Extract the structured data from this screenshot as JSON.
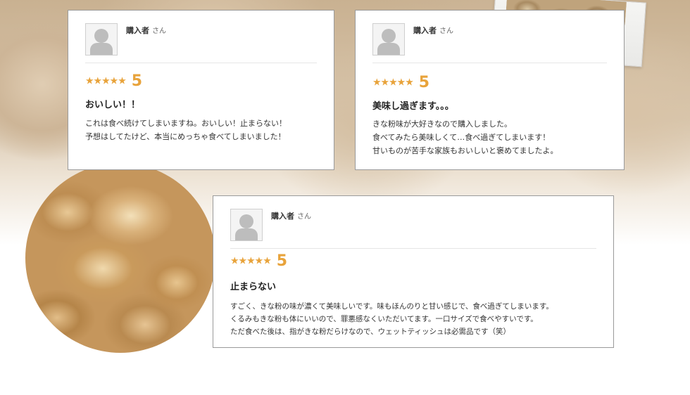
{
  "reviews": [
    {
      "reviewer": "購入者",
      "honorific": "さん",
      "stars": "★★★★★",
      "score": "5",
      "title": "おいしい！！",
      "lines": [
        "これは食べ続けてしまいますね。おいしい！止まらない！",
        "予想はしてたけど、本当にめっちゃ食べてしまいました！"
      ]
    },
    {
      "reviewer": "購入者",
      "honorific": "さん",
      "stars": "★★★★★",
      "score": "5",
      "title": "美味し過ぎます。。。",
      "lines": [
        "きな粉味が大好きなので購入しました。",
        "食べてみたら美味しくて…食べ過ぎてしまいます！",
        "甘いものが苦手な家族もおいしいと褒めてましたよ。"
      ]
    },
    {
      "reviewer": "購入者",
      "honorific": "さん",
      "stars": "★★★★★",
      "score": "5",
      "title": "止まらない",
      "lines": [
        "すごく、きな粉の味が濃くて美味しいです。味もほんのりと甘い感じで、食べ過ぎてしまいます。",
        "くるみもきな粉も体にいいので、罪悪感なくいただいてます。一口サイズで食べやすいです。",
        "ただ食べた後は、指がきな粉だらけなので、ウェットティッシュは必需品です（笑）"
      ]
    }
  ],
  "colors": {
    "accent": "#e8a33b",
    "border": "#9a9a9a",
    "text": "#333333"
  },
  "icons": {
    "avatar": "user-silhouette-icon",
    "rating": "star-icon"
  }
}
